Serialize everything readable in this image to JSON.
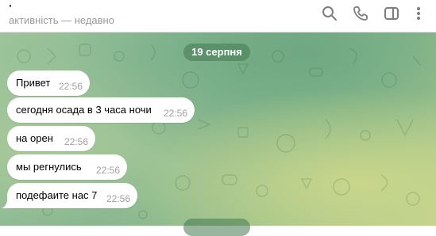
{
  "header": {
    "title": "·",
    "status": "активність — недавно",
    "icons": [
      "search-icon",
      "phone-icon",
      "sidebar-toggle-icon",
      "more-icon"
    ]
  },
  "chat": {
    "date_label": "19 серпня",
    "messages": [
      {
        "text": "Привет",
        "time": "22:56"
      },
      {
        "text": "сегодня осада в 3 часа ночи",
        "time": "22:56"
      },
      {
        "text": "на орен",
        "time": "22:56"
      },
      {
        "text": "мы регнулись",
        "time": "22:56"
      },
      {
        "text": "подефаите нас 7",
        "time": "22:56"
      }
    ]
  },
  "colors": {
    "accent": "#4f8a60",
    "bubble": "#ffffff",
    "time": "#a0a0a0"
  }
}
